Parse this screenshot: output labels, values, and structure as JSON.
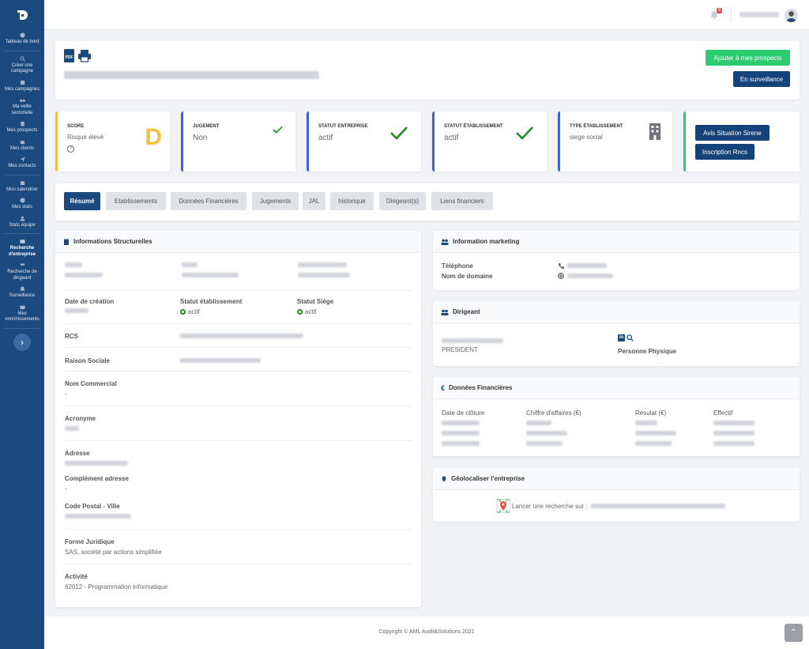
{
  "sidebar": {
    "items": [
      {
        "label": "Tableau de bord"
      },
      {
        "label": "Créer une campagne"
      },
      {
        "label": "Mes campagnes"
      },
      {
        "label": "Ma veille sectorielle"
      },
      {
        "label": "Mes prospects"
      },
      {
        "label": "Mes clients"
      },
      {
        "label": "Mes contacts"
      },
      {
        "label": "Mon calendrier"
      },
      {
        "label": "Mes stats"
      },
      {
        "label": "Stats équipe"
      },
      {
        "label": "Recherche d'entreprise"
      },
      {
        "label": "Recherche de dirigeant"
      },
      {
        "label": "Surveillance"
      },
      {
        "label": "Mes enrichissements"
      }
    ],
    "toggle": "›"
  },
  "topbar": {
    "notifications": "8"
  },
  "header": {
    "pdf_label": "PDF",
    "add_prospect": "Ajouter à mes prospects",
    "monitor": "En surveillance"
  },
  "kpis": {
    "score": {
      "label": "SCORE",
      "value": "Risque élevé",
      "grade": "D",
      "help": "?"
    },
    "jugement": {
      "label": "JUGEMENT",
      "value": "Non"
    },
    "statut_entreprise": {
      "label": "STATUT ENTREPRISE",
      "value": "actif"
    },
    "statut_etablissement": {
      "label": "STATUT ÉTABLISSEMENT",
      "value": "actif"
    },
    "type_etablissement": {
      "label": "TYPE ÉTABLISSEMENT",
      "value": "siege social"
    },
    "avis_button": "Avis Situation Sirene",
    "rncs_button": "Inscription Rncs"
  },
  "tabs": [
    "Résumé",
    "Etablissements",
    "Données Financières",
    "Jugements",
    "JAL",
    "historique",
    "Dirigeant(s)",
    "Liens financiers"
  ],
  "structure": {
    "title": "Informations Structurelles",
    "date_creation": "Date de création",
    "statut_etab": "Statut établissement",
    "statut_etab_val": "actif",
    "statut_siege": "Statut Siège",
    "statut_siege_val": "actif",
    "rcs": "RCS",
    "raison_sociale": "Raison Sociale",
    "nom_commercial": "Nom Commercial",
    "nom_commercial_val": "-",
    "acronyme": "Acronyme",
    "adresse": "Adresse",
    "complement": "Complément adresse",
    "complement_val": "-",
    "cp_ville": "Code Postal - Ville",
    "forme": "Forme Juridique",
    "forme_val": "SAS, société par actions simplifiée",
    "activite": "Activité",
    "activite_val": "62012 - Programmation informatique"
  },
  "marketing": {
    "title": "Information marketing",
    "telephone": "Téléphone",
    "domaine": "Nom de domaine"
  },
  "dirigeant": {
    "title": "Dirigeant",
    "role": "PRESIDENT",
    "linkedin": "in",
    "type": "Personne Physique"
  },
  "financier": {
    "title": "Données Financières",
    "cols": [
      "Date de clôture",
      "Chiffre d'affaires (€)",
      "Résulat (€)",
      "Effectif"
    ]
  },
  "geo": {
    "title": "Géolocaliser l'entreprise",
    "search": "Lancer une recherche sur :"
  },
  "footer": {
    "copyright": "Copyright © AML Audit&Solutions 2021",
    "scroll_top": "⌃"
  }
}
